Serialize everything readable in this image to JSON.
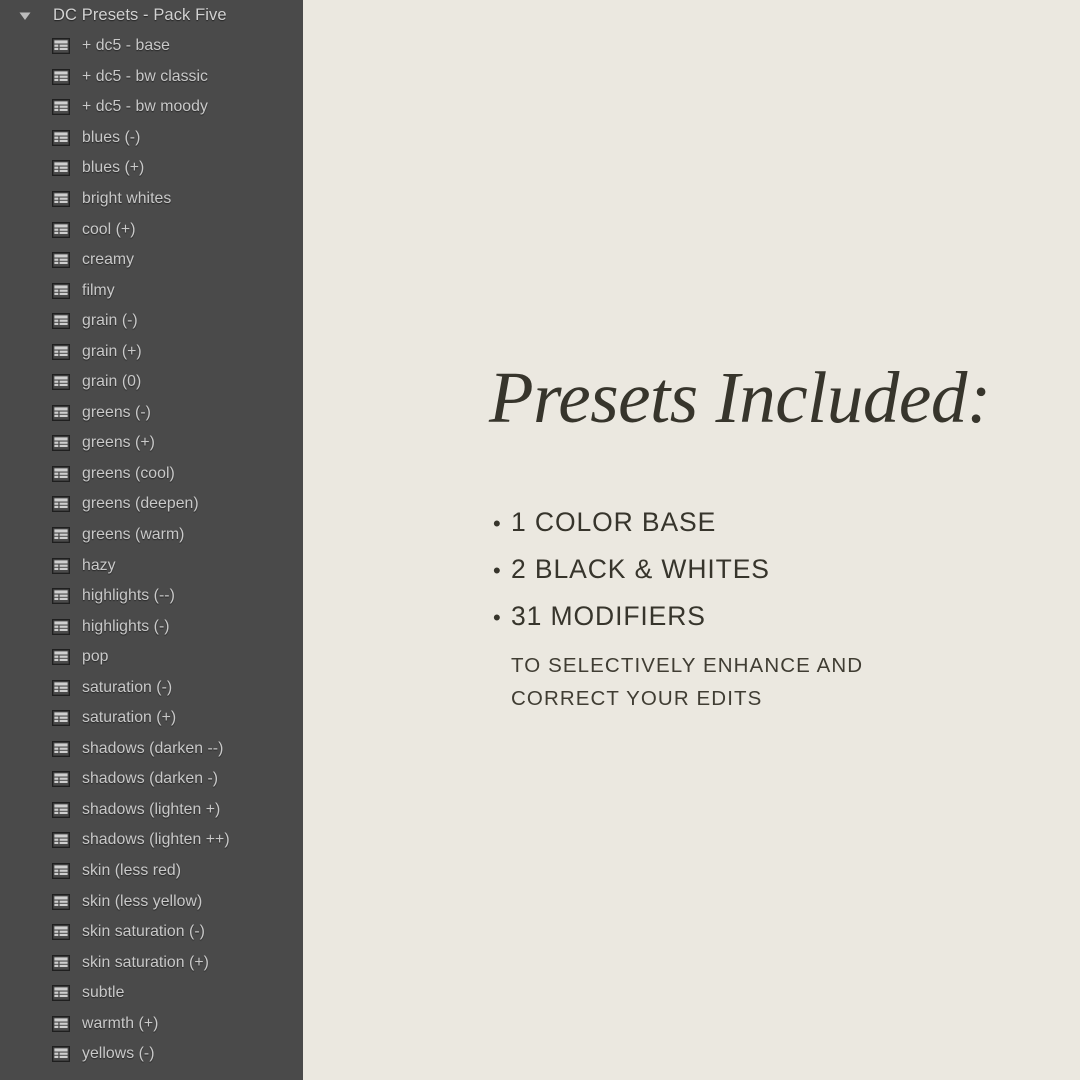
{
  "sidebar": {
    "background_color": "#4a4a4a",
    "text_color": "#c9c9c9",
    "group": {
      "disclosure_icon": "triangle-down-icon",
      "title": "DC Presets - Pack Five",
      "expanded": true
    },
    "item_icon": "table-grid-icon",
    "items": [
      {
        "label": "+ dc5 - base"
      },
      {
        "label": "+ dc5 - bw classic"
      },
      {
        "label": "+ dc5 - bw moody"
      },
      {
        "label": "blues (-)"
      },
      {
        "label": "blues (+)"
      },
      {
        "label": "bright whites"
      },
      {
        "label": "cool (+)"
      },
      {
        "label": "creamy"
      },
      {
        "label": "filmy"
      },
      {
        "label": "grain (-)"
      },
      {
        "label": "grain (+)"
      },
      {
        "label": "grain (0)"
      },
      {
        "label": "greens (-)"
      },
      {
        "label": "greens (+)"
      },
      {
        "label": "greens (cool)"
      },
      {
        "label": "greens (deepen)"
      },
      {
        "label": "greens (warm)"
      },
      {
        "label": "hazy"
      },
      {
        "label": "highlights (--)"
      },
      {
        "label": "highlights (-)"
      },
      {
        "label": "pop"
      },
      {
        "label": "saturation (-)"
      },
      {
        "label": "saturation (+)"
      },
      {
        "label": "shadows (darken --)"
      },
      {
        "label": "shadows (darken -)"
      },
      {
        "label": "shadows (lighten +)"
      },
      {
        "label": "shadows (lighten ++)"
      },
      {
        "label": "skin (less red)"
      },
      {
        "label": "skin (less yellow)"
      },
      {
        "label": "skin saturation (-)"
      },
      {
        "label": "skin saturation (+)"
      },
      {
        "label": "subtle"
      },
      {
        "label": "warmth (+)"
      },
      {
        "label": "yellows (-)"
      }
    ]
  },
  "content": {
    "background_color": "#ebe8e0",
    "text_color": "#37352c",
    "headline": "Presets Included:",
    "bullet_marker": "•",
    "bullets": [
      {
        "text": "1 COLOR BASE"
      },
      {
        "text": "2 BLACK & WHITES"
      },
      {
        "text": "31 MODIFIERS"
      }
    ],
    "subcaption": {
      "line1": "TO SELECTIVELY ENHANCE AND",
      "line2": "CORRECT YOUR EDITS"
    }
  }
}
